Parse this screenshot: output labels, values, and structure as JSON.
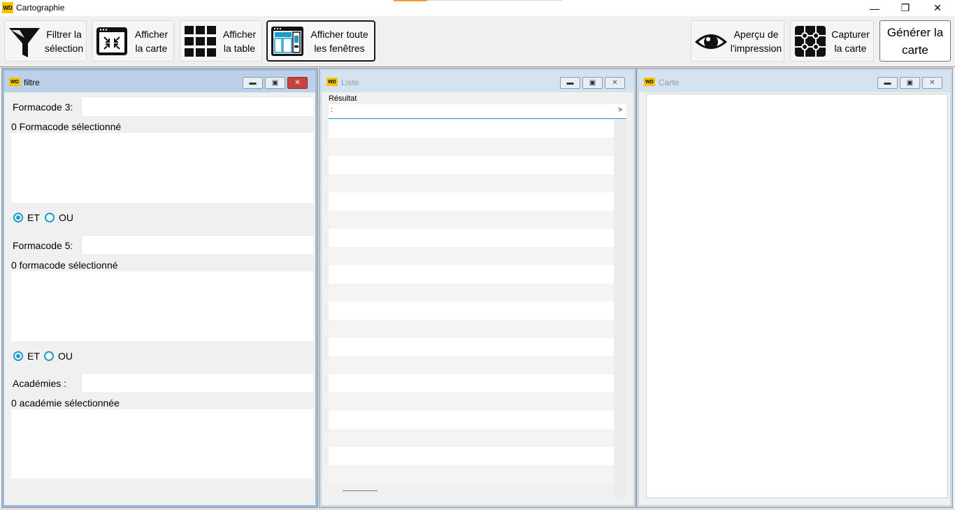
{
  "app": {
    "logo_text": "WD",
    "title": "Cartographie",
    "window_controls": {
      "minimize": "—",
      "restore": "❐",
      "close": "✕"
    }
  },
  "toolbar": {
    "filter_label": "Filtrer la\nsélection",
    "show_map_label": "Afficher\nla carte",
    "show_table_label": "Afficher\nla table",
    "show_all_label": "Afficher toute\nles fenêtres",
    "print_preview_label": "Aperçu de\nl'impression",
    "capture_label": "Capturer\nla carte",
    "generate_label": "Générer la\ncarte"
  },
  "windows": {
    "filtre": {
      "logo_text": "WD",
      "title": "filtre",
      "formacode3_label": "Formacode 3:",
      "formacode3_value": "",
      "formacode3_count": "0 Formacode sélectionné",
      "op1_et": "ET",
      "op1_ou": "OU",
      "op1_selected": "ET",
      "formacode5_label": "Formacode 5:",
      "formacode5_value": "",
      "formacode5_count": "0 formacode sélectionné",
      "op2_et": "ET",
      "op2_ou": "OU",
      "op2_selected": "ET",
      "academies_label": "Académies :",
      "academies_value": "",
      "academies_count": "0 académie sélectionnée"
    },
    "liste": {
      "logo_text": "WD",
      "title": "Liste",
      "table_title": "Résultat",
      "column_header": ":",
      "scroll_arrow": ">"
    },
    "carte": {
      "logo_text": "WD",
      "title": "Carte"
    },
    "child_controls": {
      "minimize": "▬",
      "restore": "▣",
      "close": "✕"
    }
  },
  "colors": {
    "accent": "#1a9bc8",
    "wd_logo": "#f5c400",
    "close_button": "#c8433a"
  }
}
